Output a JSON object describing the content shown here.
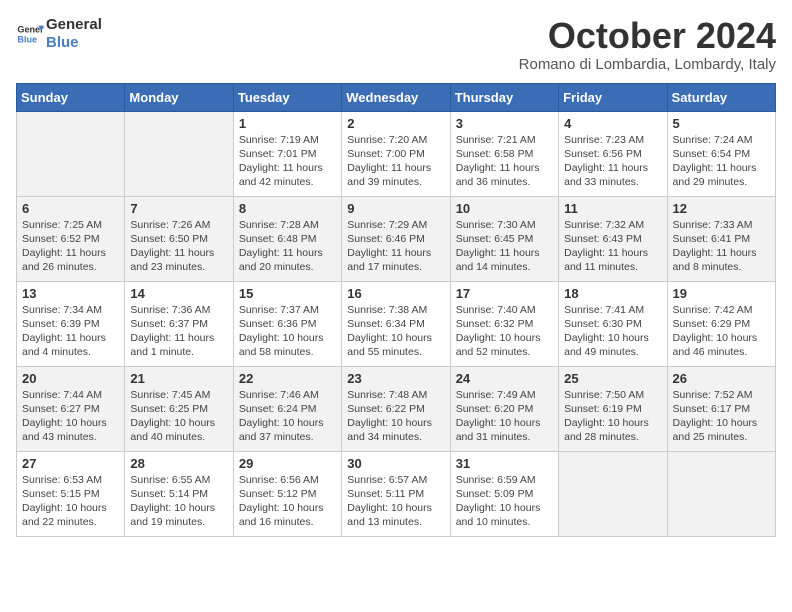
{
  "logo": {
    "line1": "General",
    "line2": "Blue"
  },
  "title": "October 2024",
  "location": "Romano di Lombardia, Lombardy, Italy",
  "days_of_week": [
    "Sunday",
    "Monday",
    "Tuesday",
    "Wednesday",
    "Thursday",
    "Friday",
    "Saturday"
  ],
  "weeks": [
    [
      {
        "day": "",
        "info": ""
      },
      {
        "day": "",
        "info": ""
      },
      {
        "day": "1",
        "info": "Sunrise: 7:19 AM\nSunset: 7:01 PM\nDaylight: 11 hours and 42 minutes."
      },
      {
        "day": "2",
        "info": "Sunrise: 7:20 AM\nSunset: 7:00 PM\nDaylight: 11 hours and 39 minutes."
      },
      {
        "day": "3",
        "info": "Sunrise: 7:21 AM\nSunset: 6:58 PM\nDaylight: 11 hours and 36 minutes."
      },
      {
        "day": "4",
        "info": "Sunrise: 7:23 AM\nSunset: 6:56 PM\nDaylight: 11 hours and 33 minutes."
      },
      {
        "day": "5",
        "info": "Sunrise: 7:24 AM\nSunset: 6:54 PM\nDaylight: 11 hours and 29 minutes."
      }
    ],
    [
      {
        "day": "6",
        "info": "Sunrise: 7:25 AM\nSunset: 6:52 PM\nDaylight: 11 hours and 26 minutes."
      },
      {
        "day": "7",
        "info": "Sunrise: 7:26 AM\nSunset: 6:50 PM\nDaylight: 11 hours and 23 minutes."
      },
      {
        "day": "8",
        "info": "Sunrise: 7:28 AM\nSunset: 6:48 PM\nDaylight: 11 hours and 20 minutes."
      },
      {
        "day": "9",
        "info": "Sunrise: 7:29 AM\nSunset: 6:46 PM\nDaylight: 11 hours and 17 minutes."
      },
      {
        "day": "10",
        "info": "Sunrise: 7:30 AM\nSunset: 6:45 PM\nDaylight: 11 hours and 14 minutes."
      },
      {
        "day": "11",
        "info": "Sunrise: 7:32 AM\nSunset: 6:43 PM\nDaylight: 11 hours and 11 minutes."
      },
      {
        "day": "12",
        "info": "Sunrise: 7:33 AM\nSunset: 6:41 PM\nDaylight: 11 hours and 8 minutes."
      }
    ],
    [
      {
        "day": "13",
        "info": "Sunrise: 7:34 AM\nSunset: 6:39 PM\nDaylight: 11 hours and 4 minutes."
      },
      {
        "day": "14",
        "info": "Sunrise: 7:36 AM\nSunset: 6:37 PM\nDaylight: 11 hours and 1 minute."
      },
      {
        "day": "15",
        "info": "Sunrise: 7:37 AM\nSunset: 6:36 PM\nDaylight: 10 hours and 58 minutes."
      },
      {
        "day": "16",
        "info": "Sunrise: 7:38 AM\nSunset: 6:34 PM\nDaylight: 10 hours and 55 minutes."
      },
      {
        "day": "17",
        "info": "Sunrise: 7:40 AM\nSunset: 6:32 PM\nDaylight: 10 hours and 52 minutes."
      },
      {
        "day": "18",
        "info": "Sunrise: 7:41 AM\nSunset: 6:30 PM\nDaylight: 10 hours and 49 minutes."
      },
      {
        "day": "19",
        "info": "Sunrise: 7:42 AM\nSunset: 6:29 PM\nDaylight: 10 hours and 46 minutes."
      }
    ],
    [
      {
        "day": "20",
        "info": "Sunrise: 7:44 AM\nSunset: 6:27 PM\nDaylight: 10 hours and 43 minutes."
      },
      {
        "day": "21",
        "info": "Sunrise: 7:45 AM\nSunset: 6:25 PM\nDaylight: 10 hours and 40 minutes."
      },
      {
        "day": "22",
        "info": "Sunrise: 7:46 AM\nSunset: 6:24 PM\nDaylight: 10 hours and 37 minutes."
      },
      {
        "day": "23",
        "info": "Sunrise: 7:48 AM\nSunset: 6:22 PM\nDaylight: 10 hours and 34 minutes."
      },
      {
        "day": "24",
        "info": "Sunrise: 7:49 AM\nSunset: 6:20 PM\nDaylight: 10 hours and 31 minutes."
      },
      {
        "day": "25",
        "info": "Sunrise: 7:50 AM\nSunset: 6:19 PM\nDaylight: 10 hours and 28 minutes."
      },
      {
        "day": "26",
        "info": "Sunrise: 7:52 AM\nSunset: 6:17 PM\nDaylight: 10 hours and 25 minutes."
      }
    ],
    [
      {
        "day": "27",
        "info": "Sunrise: 6:53 AM\nSunset: 5:15 PM\nDaylight: 10 hours and 22 minutes."
      },
      {
        "day": "28",
        "info": "Sunrise: 6:55 AM\nSunset: 5:14 PM\nDaylight: 10 hours and 19 minutes."
      },
      {
        "day": "29",
        "info": "Sunrise: 6:56 AM\nSunset: 5:12 PM\nDaylight: 10 hours and 16 minutes."
      },
      {
        "day": "30",
        "info": "Sunrise: 6:57 AM\nSunset: 5:11 PM\nDaylight: 10 hours and 13 minutes."
      },
      {
        "day": "31",
        "info": "Sunrise: 6:59 AM\nSunset: 5:09 PM\nDaylight: 10 hours and 10 minutes."
      },
      {
        "day": "",
        "info": ""
      },
      {
        "day": "",
        "info": ""
      }
    ]
  ]
}
